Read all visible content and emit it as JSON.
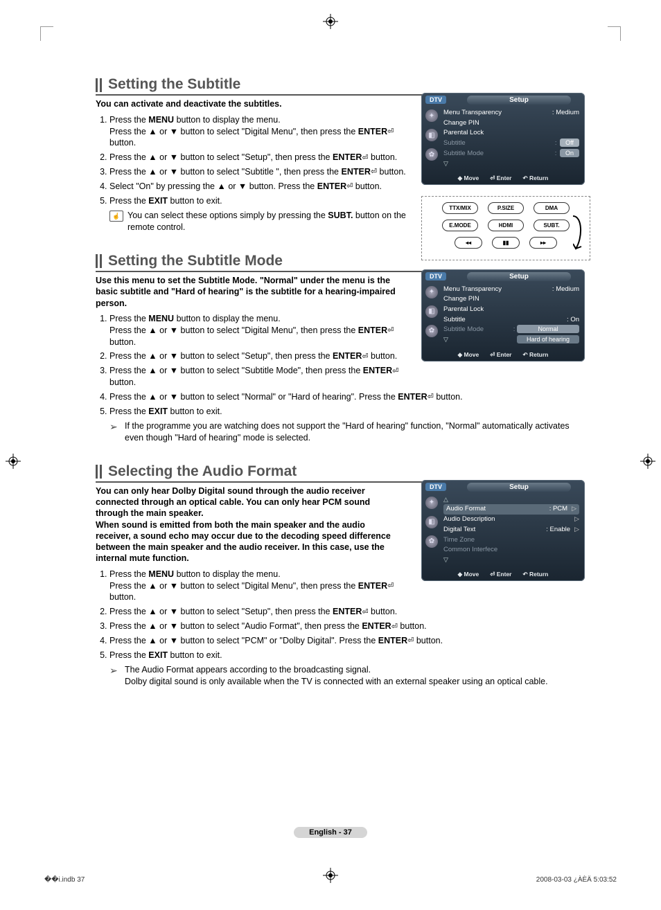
{
  "sections": [
    {
      "title": "Setting the Subtitle",
      "intro": "You can activate and deactivate the subtitles.",
      "steps": [
        "Press the <b>MENU</b> button to display the menu.<br>Press the ▲ or ▼ button to select \"Digital Menu\", then press the <b>ENTER</b><span class='enter-icon'>⏎</span> button.",
        "Press the ▲ or ▼ button to select \"Setup\", then press the <b>ENTER</b><span class='enter-icon'>⏎</span> button.",
        "Press the ▲ or ▼ button to select \"Subtitle \", then press the <b>ENTER</b><span class='enter-icon'>⏎</span> button.",
        "Select \"On\" by pressing the ▲ or ▼ button. Press the <b>ENTER</b><span class='enter-icon'>⏎</span> button.",
        "Press the <b>EXIT</b> button to exit."
      ],
      "note_icon": "hand",
      "note": "You can select these options simply by pressing the <b>SUBT.</b> button on the remote control."
    },
    {
      "title": "Setting the Subtitle Mode",
      "intro": "Use this menu to set the Subtitle Mode. \"Normal\" under the menu is the basic subtitle and \"Hard of hearing\" is the subtitle for a hearing-impaired person.",
      "steps": [
        "Press the <b>MENU</b> button to display the menu.<br>Press the ▲ or ▼ button to select \"Digital Menu\", then press the <b>ENTER</b><span class='enter-icon'>⏎</span> button.",
        "Press the ▲ or ▼ button to select \"Setup\", then press the <b>ENTER</b><span class='enter-icon'>⏎</span> button.",
        "Press the ▲ or ▼ button to select \"Subtitle  Mode\", then press the <b>ENTER</b><span class='enter-icon'>⏎</span> button.",
        "Press the ▲ or ▼ button to select \"Normal\" or \"Hard of hearing\". Press the <b>ENTER</b><span class='enter-icon'>⏎</span> button.",
        "Press the <b>EXIT</b> button to exit."
      ],
      "note_icon": "arrow",
      "note": "If the programme you are watching does not support the \"Hard of hearing\" function, \"Normal\" automatically activates even though \"Hard of hearing\" mode is selected."
    },
    {
      "title": "Selecting the Audio Format",
      "intro": "You can only hear Dolby Digital sound through the audio receiver connected through an optical cable. You can only hear PCM sound through the main speaker.<br>When sound is emitted from both the main speaker and the audio receiver, a sound echo may occur due to the decoding speed difference between the main speaker and the audio receiver. In this case, use the internal mute function.",
      "steps": [
        "Press the <b>MENU</b> button to display the menu.<br>Press the ▲ or ▼ button to select \"Digital Menu\", then press the <b>ENTER</b><span class='enter-icon'>⏎</span> button.",
        "Press the ▲ or ▼ button to select \"Setup\", then press the <b>ENTER</b><span class='enter-icon'>⏎</span> button.",
        "Press the ▲ or ▼ button to select \"Audio Format\", then press the <b>ENTER</b><span class='enter-icon'>⏎</span> button.",
        "Press the ▲ or ▼ button to select \"PCM\" or \"Dolby Digital\". Press the <b>ENTER</b><span class='enter-icon'>⏎</span> button.",
        "Press the <b>EXIT</b> button to exit."
      ],
      "note_icon": "arrow",
      "note": "The Audio Format appears according to the broadcasting signal.<br>Dolby digital sound is only available when the TV is connected with an external speaker using an optical cable."
    }
  ],
  "osd1": {
    "dtv": "DTV",
    "title": "Setup",
    "rows": [
      {
        "lab": "Menu Transparency",
        "val": ": Medium"
      },
      {
        "lab": "Change PIN",
        "val": ""
      },
      {
        "lab": "Parental Lock",
        "val": ""
      }
    ],
    "subtitle_lab": "Subtitle",
    "subtitle_colon": ":",
    "off": "Off",
    "on": "On",
    "mode_lab": "Subtitle  Mode",
    "mode_colon": ":",
    "move": "Move",
    "enter": "Enter",
    "ret": "Return"
  },
  "osd2": {
    "dtv": "DTV",
    "title": "Setup",
    "rows": [
      {
        "lab": "Menu Transparency",
        "val": ": Medium"
      },
      {
        "lab": "Change PIN",
        "val": ""
      },
      {
        "lab": "Parental Lock",
        "val": ""
      },
      {
        "lab": "Subtitle",
        "val": ": On"
      }
    ],
    "mode_lab": "Subtitle  Mode",
    "mode_colon": ":",
    "normal": "Normal",
    "hard": "Hard of hearing",
    "move": "Move",
    "enter": "Enter",
    "ret": "Return"
  },
  "osd3": {
    "dtv": "DTV",
    "title": "Setup",
    "af_lab": "Audio Format",
    "af_val": ": PCM",
    "ad_lab": "Audio Description",
    "dt_lab": "Digital Text",
    "dt_val": ": Enable",
    "tz_lab": "Time Zone",
    "ci_lab": "Common Interfece",
    "move": "Move",
    "enter": "Enter",
    "ret": "Return"
  },
  "remote": {
    "b1": "TTX/MIX",
    "b2": "P.SIZE",
    "b3": "DMA",
    "b4": "E.MODE",
    "b5": "HDMI",
    "b6": "SUBT."
  },
  "pagefoot": "English - 37",
  "docfoot_left": "��i.indb   37",
  "docfoot_right": "2008-03-03   ¿ÀÈÄ 5:03:52"
}
